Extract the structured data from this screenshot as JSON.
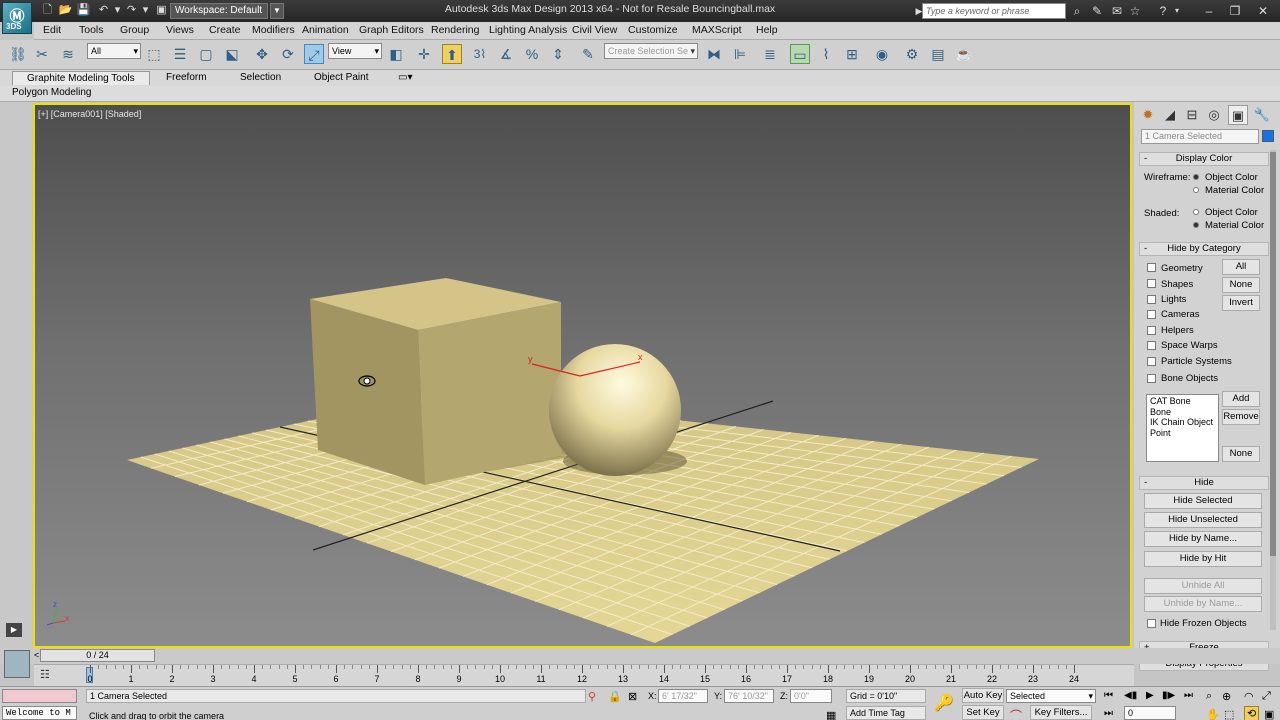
{
  "app": {
    "logo": "3DS",
    "title": "Autodesk 3ds Max Design 2013 x64    - Not for Resale    Bouncingball.max",
    "workspace": "Workspace: Default"
  },
  "quick_access": [
    "new-icon",
    "open-icon",
    "save-icon",
    "undo-icon",
    "redo-icon",
    "hold-icon"
  ],
  "search": {
    "placeholder": "Type a keyword or phrase"
  },
  "menu": [
    "Edit",
    "Tools",
    "Group",
    "Views",
    "Create",
    "Modifiers",
    "Animation",
    "Graph Editors",
    "Rendering",
    "Lighting Analysis",
    "Civil View",
    "Customize",
    "MAXScript",
    "Help"
  ],
  "toolbar": {
    "selection_filter": "All",
    "reference_coord": "View",
    "named_selection": "Create Selection Se",
    "snap_label": "3"
  },
  "ribbon": {
    "tabs": [
      "Graphite Modeling Tools",
      "Freeform",
      "Selection",
      "Object Paint"
    ],
    "subtab": "Polygon Modeling"
  },
  "viewport": {
    "label": "[+] [Camera001] [Shaded]",
    "axis_x": "x",
    "axis_y": "y",
    "axis_z": "z"
  },
  "command_panel": {
    "selection_name": "1 Camera Selected",
    "selection_color": "#1473e6",
    "display_color": {
      "title": "Display Color",
      "wireframe_label": "Wireframe:",
      "shaded_label": "Shaded:",
      "object_color": "Object Color",
      "material_color": "Material Color"
    },
    "hide_by_category": {
      "title": "Hide by Category",
      "categories": [
        "Geometry",
        "Shapes",
        "Lights",
        "Cameras",
        "Helpers",
        "Space Warps",
        "Particle Systems",
        "Bone Objects"
      ],
      "all": "All",
      "none": "None",
      "invert": "Invert",
      "list": [
        "CAT Bone",
        "Bone",
        "IK Chain Object",
        "Point"
      ],
      "add": "Add",
      "remove": "Remove",
      "none2": "None"
    },
    "hide": {
      "title": "Hide",
      "hide_selected": "Hide Selected",
      "hide_unselected": "Hide Unselected",
      "hide_by_name": "Hide by Name...",
      "hide_by_hit": "Hide by Hit",
      "unhide_all": "Unhide All",
      "unhide_by_name": "Unhide by Name...",
      "hide_frozen": "Hide Frozen Objects"
    },
    "freeze": "Freeze",
    "display_properties": "Display Properties"
  },
  "timeline": {
    "slider": "0 / 24",
    "prev": "<",
    "next": ">",
    "ticks": [
      "0",
      "1",
      "2",
      "3",
      "4",
      "5",
      "6",
      "7",
      "8",
      "9",
      "10",
      "11",
      "12",
      "13",
      "14",
      "15",
      "16",
      "17",
      "18",
      "19",
      "20",
      "21",
      "22",
      "23",
      "24"
    ]
  },
  "status": {
    "maxscript": "Welcome to M",
    "selection": "1 Camera Selected",
    "prompt": "Click and drag to orbit the camera",
    "x_label": "X:",
    "x_value": "6' 17/32\"",
    "y_label": "Y:",
    "y_value": "76' 10/32\"",
    "z_label": "Z:",
    "z_value": "0'0\"",
    "grid": "Grid = 0'10\"",
    "add_time_tag": "Add Time Tag",
    "auto_key": "Auto Key",
    "set_key": "Set Key",
    "key_mode": "Selected",
    "key_filters": "Key Filters...",
    "frame": "0"
  }
}
